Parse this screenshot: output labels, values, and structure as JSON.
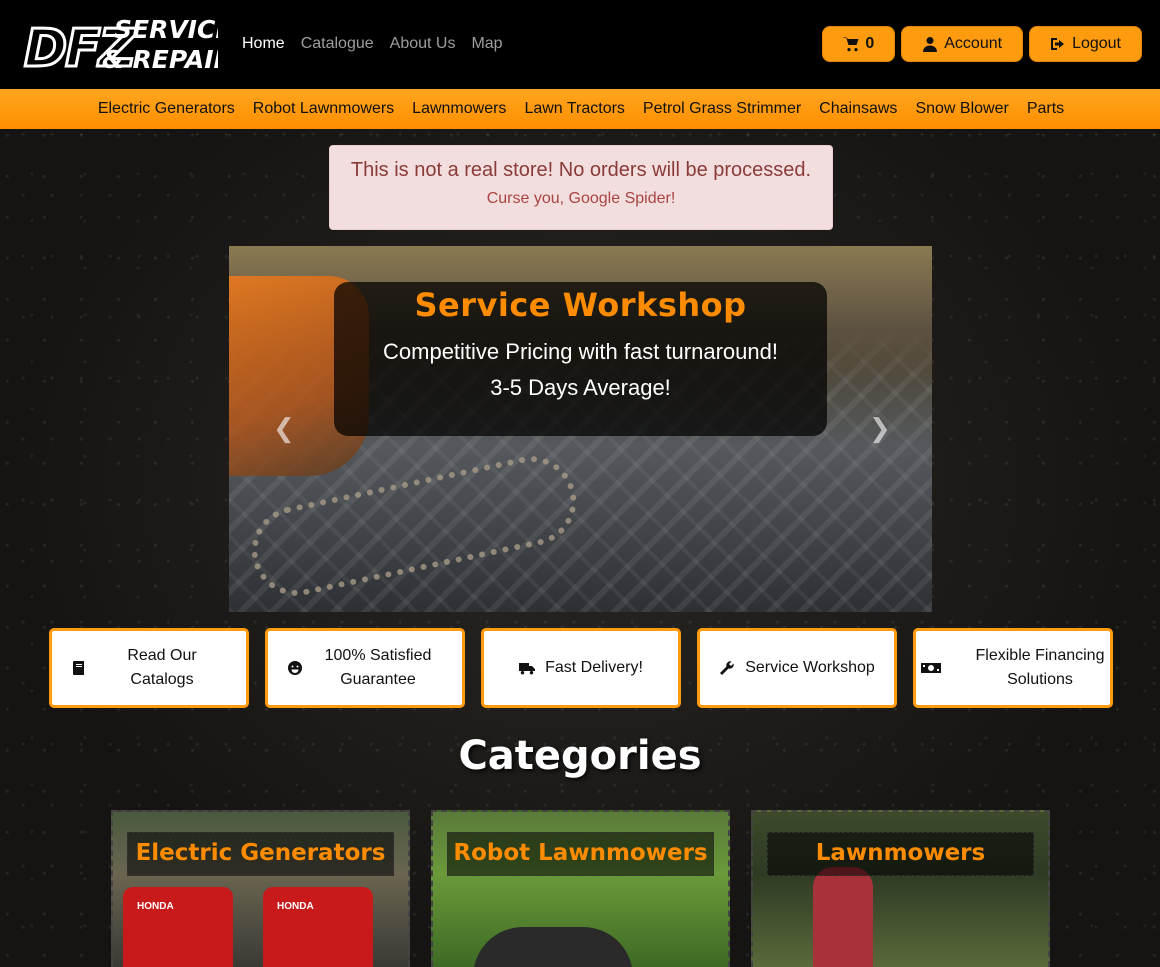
{
  "header": {
    "logo_line1": "DFZ",
    "logo_line2": "SERVICE",
    "logo_line3": "& REPAIR",
    "nav": [
      {
        "label": "Home",
        "active": true
      },
      {
        "label": "Catalogue"
      },
      {
        "label": "About Us"
      },
      {
        "label": "Map"
      }
    ],
    "cart_count": "0",
    "account_label": "Account",
    "logout_label": "Logout"
  },
  "category_bar": [
    "Electric Generators",
    "Robot Lawnmowers",
    "Lawnmowers",
    "Lawn Tractors",
    "Petrol Grass Strimmer",
    "Chainsaws",
    "Snow Blower",
    "Parts"
  ],
  "alert": {
    "line1": "This is not a real store! No orders will be processed.",
    "line2": "Curse you, Google Spider!"
  },
  "carousel": {
    "title": "Service Workshop",
    "line1": "Competitive Pricing with fast turnaround!",
    "line2": "3-5 Days Average!",
    "prev_icon": "chevron-left-icon",
    "next_icon": "chevron-right-icon"
  },
  "features": [
    {
      "label": "Read Our Catalogs",
      "icon": "book-icon"
    },
    {
      "label": "100% Satisfied Guarantee",
      "icon": "smile-icon"
    },
    {
      "label": "Fast Delivery!",
      "icon": "truck-icon"
    },
    {
      "label": "Service Workshop",
      "icon": "wrench-icon"
    },
    {
      "label": "Flexible Financing Solutions",
      "icon": "money-icon"
    }
  ],
  "categories": {
    "heading": "Categories",
    "cards": [
      {
        "title": "Electric Generators",
        "image_text": "HONDA"
      },
      {
        "title": "Robot Lawnmowers"
      },
      {
        "title": "Lawnmowers"
      }
    ]
  },
  "colors": {
    "accent": "#ff9b0f",
    "title_orange": "#ff8c00",
    "alert_bg": "#f2dede"
  }
}
